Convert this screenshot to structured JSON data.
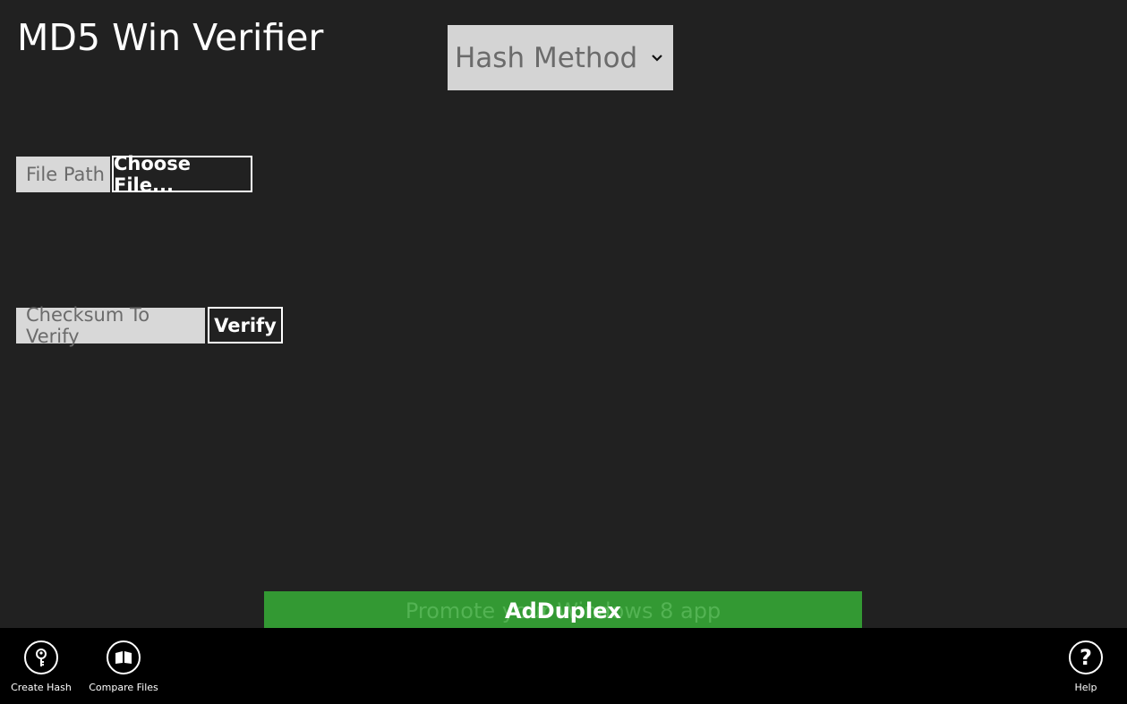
{
  "app": {
    "title": "MD5 Win Verifier"
  },
  "hash_method": {
    "label": "Hash Method",
    "chevron_icon": "chevron-down-icon"
  },
  "file_section": {
    "file_path_placeholder": "File Path",
    "choose_file_label": "Choose File..."
  },
  "checksum_section": {
    "checksum_placeholder": "Checksum To Verify",
    "verify_label": "Verify"
  },
  "ad": {
    "background_text": "Promote your Windows 8 app",
    "brand": "AdDuplex",
    "color": "#339933"
  },
  "appbar": {
    "create_hash": {
      "label": "Create Hash",
      "icon": "key-icon"
    },
    "compare_files": {
      "label": "Compare Files",
      "icon": "compare-files-icon"
    },
    "help": {
      "label": "Help",
      "icon": "help-icon"
    }
  },
  "colors": {
    "background": "#212121",
    "appbar": "#000000",
    "input_fill": "#d8d8d8",
    "text": "#ffffff"
  }
}
